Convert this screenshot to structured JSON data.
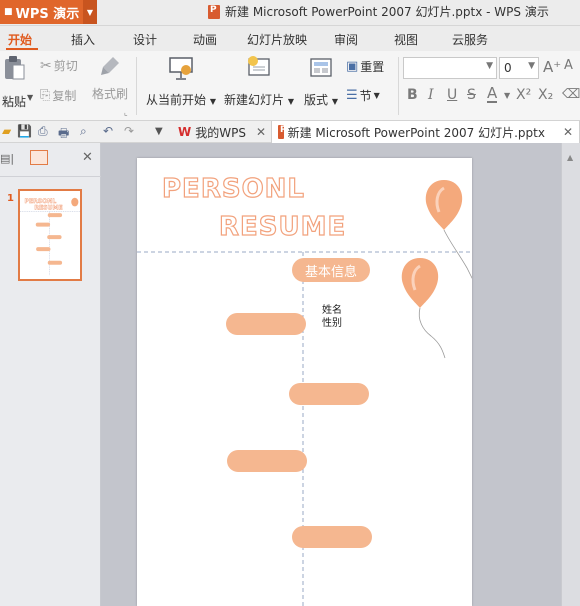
{
  "window": {
    "app_button_label": "WPS 演示",
    "title": "新建 Microsoft PowerPoint 2007 幻灯片.pptx - WPS 演示"
  },
  "ribbon_tabs": [
    "开始",
    "插入",
    "设计",
    "动画",
    "幻灯片放映",
    "审阅",
    "视图",
    "云服务"
  ],
  "ribbon": {
    "paste": "粘贴",
    "cut": "剪切",
    "copy": "复制",
    "format_painter": "格式刷",
    "from_current": "从当前开始",
    "new_slide": "新建幻灯片",
    "layout": "版式",
    "reset": "重置",
    "section": "节",
    "font_size": "0"
  },
  "doc_tabs": {
    "my_wps": "我的WPS",
    "current_doc": "新建 Microsoft PowerPoint 2007 幻灯片.pptx"
  },
  "thumbnail": {
    "slide_number": "1"
  },
  "slide": {
    "title_line1": "PERSONL",
    "title_line2": "RESUME",
    "section_label": "基本信息",
    "field_name": "姓名",
    "field_gender": "性别"
  },
  "colors": {
    "accent": "#e05a1e",
    "pill": "#f5b790",
    "balloon": "#f4a97c"
  }
}
